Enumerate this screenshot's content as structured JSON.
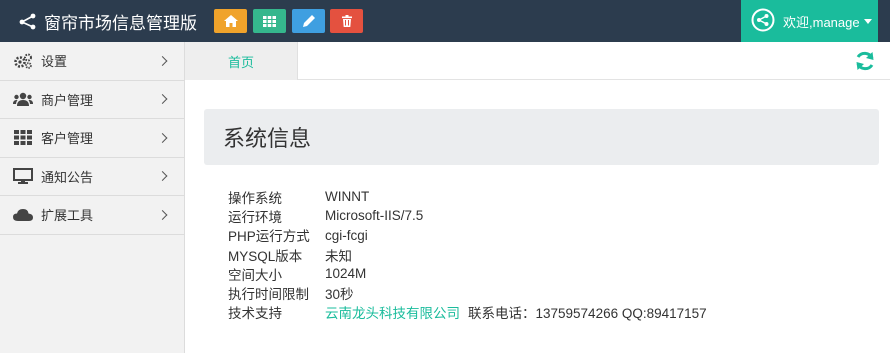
{
  "app": {
    "title": "窗帘市场信息管理版",
    "user_greeting": "欢迎,manage"
  },
  "toolbar": {
    "buttons": [
      {
        "icon": "home-icon",
        "color": "#f0a32b"
      },
      {
        "icon": "grid-icon",
        "color": "#35b78d"
      },
      {
        "icon": "pencil-icon",
        "color": "#3f9fe1"
      },
      {
        "icon": "trash-icon",
        "color": "#e4513f"
      }
    ]
  },
  "sidebar": {
    "items": [
      {
        "label": "设置",
        "icon": "gears-icon"
      },
      {
        "label": "商户管理",
        "icon": "users-icon"
      },
      {
        "label": "客户管理",
        "icon": "grid-icon"
      },
      {
        "label": "通知公告",
        "icon": "monitor-icon"
      },
      {
        "label": "扩展工具",
        "icon": "cloud-icon"
      }
    ]
  },
  "tabs": {
    "home": "首页"
  },
  "panel": {
    "title": "系统信息",
    "rows": [
      {
        "key": "操作系统",
        "value": "WINNT"
      },
      {
        "key": "运行环境",
        "value": "Microsoft-IIS/7.5"
      },
      {
        "key": "PHP运行方式",
        "value": "cgi-fcgi"
      },
      {
        "key": "MYSQL版本",
        "value": "未知"
      },
      {
        "key": "空间大小",
        "value": "1024M"
      },
      {
        "key": "执行时间限制",
        "value": "30秒"
      }
    ],
    "support": {
      "key": "技术支持",
      "company": "云南龙头科技有限公司",
      "contact": "联系电话：13759574266  QQ:89417157"
    }
  },
  "colors": {
    "topbar": "#2c3c4e",
    "accent": "#1abc9c"
  }
}
